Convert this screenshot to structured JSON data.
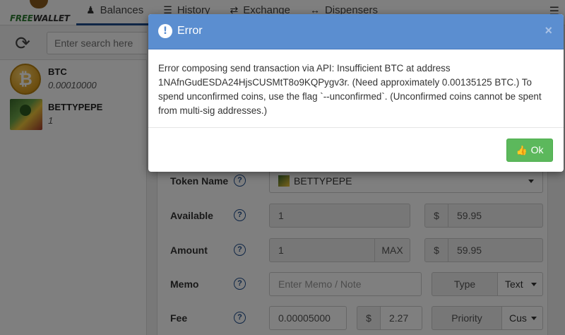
{
  "app": {
    "logo_text": "FREEWALLET",
    "nav": [
      {
        "label": "Balances",
        "icon": "user-icon"
      },
      {
        "label": "History",
        "icon": "list-icon"
      },
      {
        "label": "Exchange",
        "icon": "exchange-icon"
      },
      {
        "label": "Dispensers",
        "icon": "arrows-h-icon"
      }
    ]
  },
  "sidebar": {
    "search_placeholder": "Enter search here",
    "assets": [
      {
        "name": "BTC",
        "quantity": "0.00010000"
      },
      {
        "name": "BETTYPEPE",
        "quantity": "1"
      }
    ]
  },
  "send_form": {
    "token_label": "Token Name",
    "token_value": "BETTYPEPE",
    "available_label": "Available",
    "available_value": "1",
    "available_usd_symbol": "$",
    "available_usd": "59.95",
    "amount_label": "Amount",
    "amount_value": "1",
    "amount_max": "MAX",
    "amount_usd_symbol": "$",
    "amount_usd": "59.95",
    "memo_label": "Memo",
    "memo_placeholder": "Enter Memo / Note",
    "memo_type_label": "Type",
    "memo_type_value": "Text",
    "fee_label": "Fee",
    "fee_value": "0.00005000",
    "fee_usd_symbol": "$",
    "fee_usd": "2.27",
    "fee_priority_label": "Priority",
    "fee_priority_value": "Cus",
    "help_glyph": "?"
  },
  "modal": {
    "title": "Error",
    "title_icon_glyph": "!",
    "close_glyph": "×",
    "message": "Error composing send transaction via API: Insufficient BTC at address 1NAfnGudESDA24HjsCUSMtT8o9KQPygv3r. (Need approximately 0.00135125 BTC.) To spend unconfirmed coins, use the flag `--unconfirmed`. (Unconfirmed coins cannot be spent from multi-sig addresses.)",
    "ok_label": "Ok"
  },
  "colors": {
    "modal_header": "#5b8ed0",
    "ok_button": "#5cb85c",
    "nav_active": "#1f4d8c"
  }
}
